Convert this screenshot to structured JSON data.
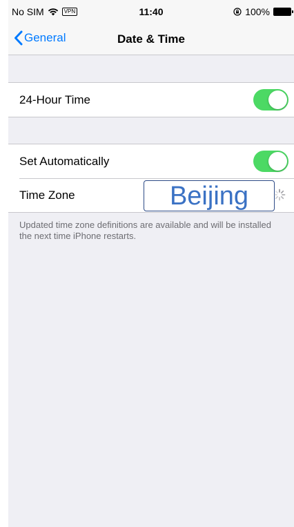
{
  "status_bar": {
    "carrier": "No SIM",
    "vpn": "VPN",
    "time": "11:40",
    "battery": "100%"
  },
  "nav": {
    "back_label": "General",
    "title": "Date & Time"
  },
  "settings": {
    "hour24": {
      "label": "24-Hour Time",
      "on": true
    },
    "set_auto": {
      "label": "Set Automatically",
      "on": true
    },
    "time_zone": {
      "label": "Time Zone",
      "value": "Beijing"
    }
  },
  "footnote": "Updated time zone definitions are available and will be installed the next time iPhone restarts.",
  "colors": {
    "accent": "#007aff",
    "toggle_on": "#4cd964",
    "annotation": "#3b72c4"
  }
}
